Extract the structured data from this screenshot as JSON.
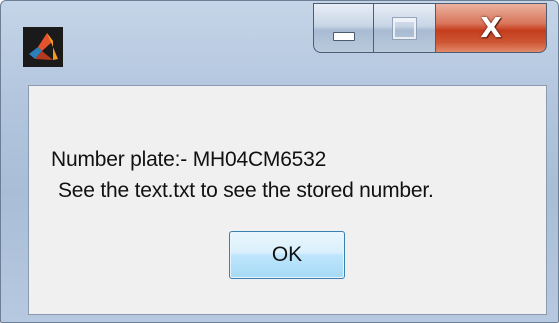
{
  "window": {
    "app_icon": "matlab-logo-icon",
    "controls": {
      "minimize_icon": "minimize-icon",
      "maximize_icon": "maximize-icon",
      "close_icon": "close-icon",
      "close_glyph": "X"
    }
  },
  "dialog": {
    "message_line_1": "Number plate:- MH04CM6532",
    "message_line_2": "See the text.txt to see the stored number.",
    "ok_label": "OK"
  },
  "colors": {
    "close_button": "#c43d1d",
    "ok_button_border": "#3c7fb1",
    "client_background": "#f0f0f0"
  }
}
